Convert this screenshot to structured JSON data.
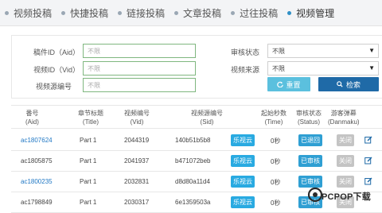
{
  "tabs": [
    {
      "label": "视频投稿"
    },
    {
      "label": "快捷投稿"
    },
    {
      "label": "链接投稿"
    },
    {
      "label": "文章投稿"
    },
    {
      "label": "过往投稿"
    },
    {
      "label": "视频管理"
    }
  ],
  "filters": {
    "aid_label": "稿件ID（Aid）",
    "aid_placeholder": "不限",
    "vid_label": "视频ID（Vid）",
    "vid_placeholder": "不限",
    "source_no_label": "视频源编号",
    "source_no_placeholder": "不限",
    "review_label": "审核状态",
    "review_value": "不限",
    "source_label": "视频来源",
    "source_value": "不限",
    "extra_value": "不限",
    "reset_label": "重置",
    "search_label": "检索"
  },
  "table": {
    "headers": [
      {
        "cn": "番号",
        "en": "(Aid)"
      },
      {
        "cn": "章节标题",
        "en": "(Title)"
      },
      {
        "cn": "视频编号",
        "en": "(Vid)"
      },
      {
        "cn": "视频源编号",
        "en": "(Sid)"
      },
      {
        "cn": "起始秒数",
        "en": "(Time)"
      },
      {
        "cn": "审核状态",
        "en": "(Status)"
      },
      {
        "cn": "游客弹幕",
        "en": "(Danmaku)"
      }
    ],
    "rows": [
      {
        "aid": "ac1807624",
        "title": "Part 1",
        "vid": "2044319",
        "sid": "140b51b5b8",
        "source": "乐视云",
        "time": "0秒",
        "status": "已退回",
        "danmaku": "关闭"
      },
      {
        "aid": "ac1805875",
        "title": "Part 1",
        "vid": "2041937",
        "sid": "b471072beb",
        "source": "乐视云",
        "time": "0秒",
        "status": "已审核",
        "danmaku": "关闭"
      },
      {
        "aid": "ac1800235",
        "title": "Part 1",
        "vid": "2032831",
        "sid": "d8d80a11d4",
        "source": "乐视云",
        "time": "0秒",
        "status": "已审核",
        "danmaku": "关闭"
      },
      {
        "aid": "ac1798849",
        "title": "Part 1",
        "vid": "2030317",
        "sid": "6e1359503a",
        "source": "乐视云",
        "time": "0秒",
        "status": "已审核",
        "danmaku": "关闭"
      }
    ]
  },
  "watermark": {
    "text": "PCPOP下载"
  },
  "colors": {
    "accent": "#1f6aa7",
    "cloud": "#29aae1",
    "status": "#2f9fd3",
    "link": "#1f77c4",
    "reset": "#5bc0de"
  }
}
